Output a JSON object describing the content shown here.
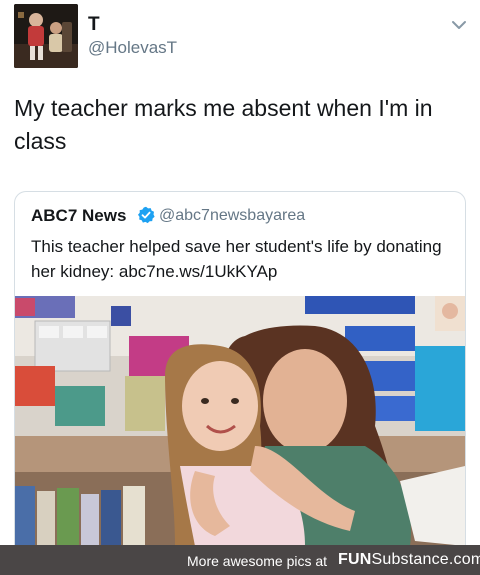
{
  "tweet": {
    "display_name": "T",
    "handle": "@HolevasT",
    "text": "My teacher marks me absent when I'm in class",
    "avatar_icon": "user-avatar-photo",
    "menu_icon": "chevron-down-icon"
  },
  "quoted_tweet": {
    "display_name": "ABC7 News",
    "verified_icon": "verified-badge-icon",
    "handle": "@abc7newsbayarea",
    "text": "This teacher helped save her student's life by donating her kidney: abc7ne.ws/1UkKYAp",
    "media": "photo-teacher-hugging-student"
  },
  "footer": {
    "text": "More awesome pics at",
    "brand_prefix": "FUN",
    "brand_suffix": "Substance",
    "brand_domain": ".com",
    "background": "#4a4646"
  },
  "colors": {
    "text": "#14171a",
    "secondary": "#657786",
    "border": "#d6dee4",
    "verified": "#1da1f2"
  }
}
